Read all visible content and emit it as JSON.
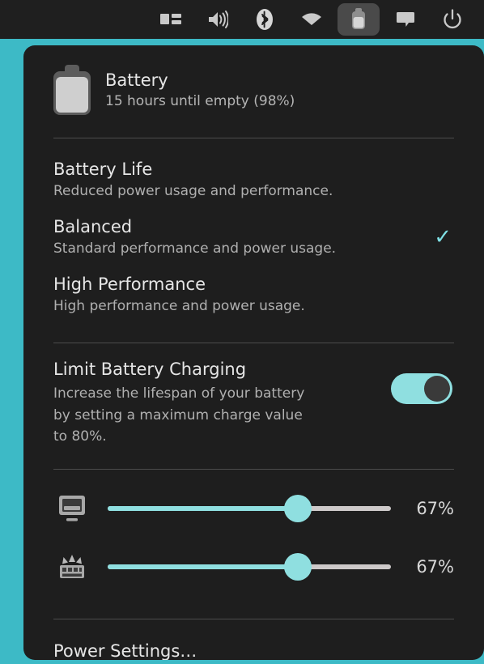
{
  "colors": {
    "desktop": "#3dbac6",
    "panel_bg": "#1e1e1e",
    "topbar_bg": "#1f1f1f",
    "accent": "#8fdfe0",
    "check": "#7fdfe4",
    "separator": "#4c4c4c",
    "text_primary": "#e6e6e6",
    "text_secondary": "#b0b0b0"
  },
  "topbar": {
    "items": [
      {
        "name": "display-layout-icon",
        "label": "Display",
        "active": false
      },
      {
        "name": "volume-icon",
        "label": "Volume",
        "active": false
      },
      {
        "name": "bluetooth-icon",
        "label": "Bluetooth",
        "active": false
      },
      {
        "name": "wifi-icon",
        "label": "Wi-Fi",
        "active": false
      },
      {
        "name": "battery-icon",
        "label": "Battery",
        "active": true
      },
      {
        "name": "chat-icon",
        "label": "Messages",
        "active": false
      },
      {
        "name": "power-icon",
        "label": "Power",
        "active": false
      }
    ]
  },
  "header": {
    "icon": "battery-icon",
    "title": "Battery",
    "subtitle": "15 hours until empty (98%)",
    "charge_percent": 98
  },
  "profiles": {
    "items": [
      {
        "title": "Battery Life",
        "description": "Reduced power usage and performance.",
        "selected": false
      },
      {
        "title": "Balanced",
        "description": "Standard performance and power usage.",
        "selected": true
      },
      {
        "title": "High Performance",
        "description": "High performance and power usage.",
        "selected": false
      }
    ],
    "check_glyph": "✓"
  },
  "limit_charging": {
    "title": "Limit Battery Charging",
    "description": "Increase the lifespan of your battery by setting a maximum charge value to 80%.",
    "toggle_state": "on"
  },
  "sliders": [
    {
      "icon": "display-brightness-icon",
      "label": "Display brightness",
      "value_label": "67%",
      "value": 67
    },
    {
      "icon": "keyboard-backlight-icon",
      "label": "Keyboard backlight",
      "value_label": "67%",
      "value": 67
    }
  ],
  "footer": {
    "power_settings_label": "Power Settings…"
  }
}
